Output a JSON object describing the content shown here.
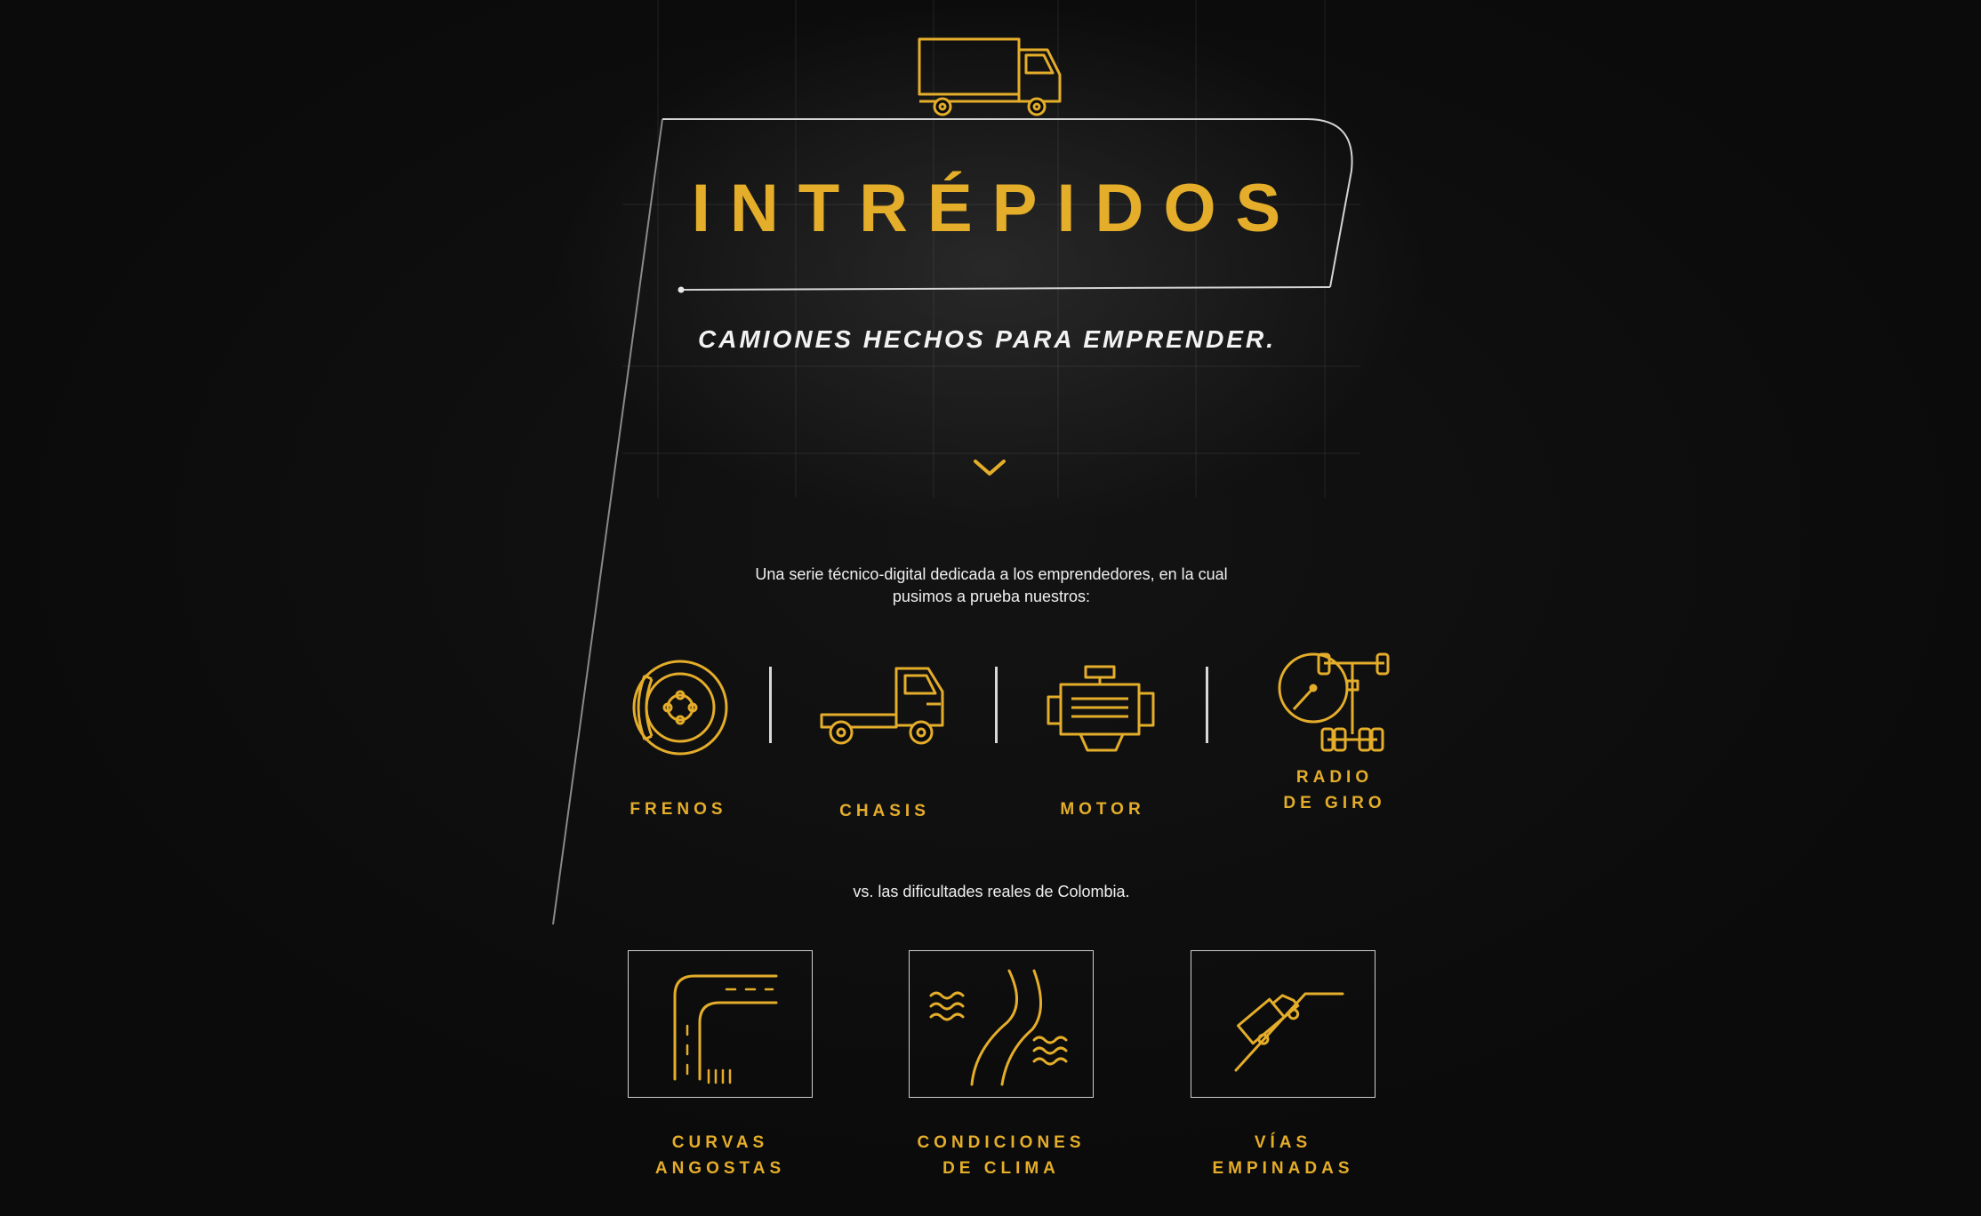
{
  "hero": {
    "title": "INTRÉPIDOS",
    "subtitle": "CAMIONES HECHOS PARA EMPRENDER."
  },
  "intro": {
    "line1": "Una serie técnico-digital dedicada a los emprendedores, en la cual",
    "line2": "pusimos a prueba nuestros:"
  },
  "features": [
    {
      "icon": "brake-disc-icon",
      "line1": "FRENOS",
      "line2": ""
    },
    {
      "icon": "chassis-truck-icon",
      "line1": "CHASIS",
      "line2": ""
    },
    {
      "icon": "engine-icon",
      "line1": "MOTOR",
      "line2": ""
    },
    {
      "icon": "turning-radius-icon",
      "line1": "RADIO",
      "line2": "DE GIRO"
    }
  ],
  "versus_text": "vs. las dificultades reales de Colombia.",
  "challenges": [
    {
      "icon": "curved-road-icon",
      "line1": "CURVAS",
      "line2": "ANGOSTAS"
    },
    {
      "icon": "weather-road-icon",
      "line1": "CONDICIONES",
      "line2": "DE CLIMA"
    },
    {
      "icon": "steep-road-icon",
      "line1": "VÍAS",
      "line2": "EMPINADAS"
    }
  ],
  "colors": {
    "accent": "#e4ad2a",
    "background": "#0b0b0b",
    "text": "#f0f0f0",
    "line": "#d8d8d8"
  }
}
